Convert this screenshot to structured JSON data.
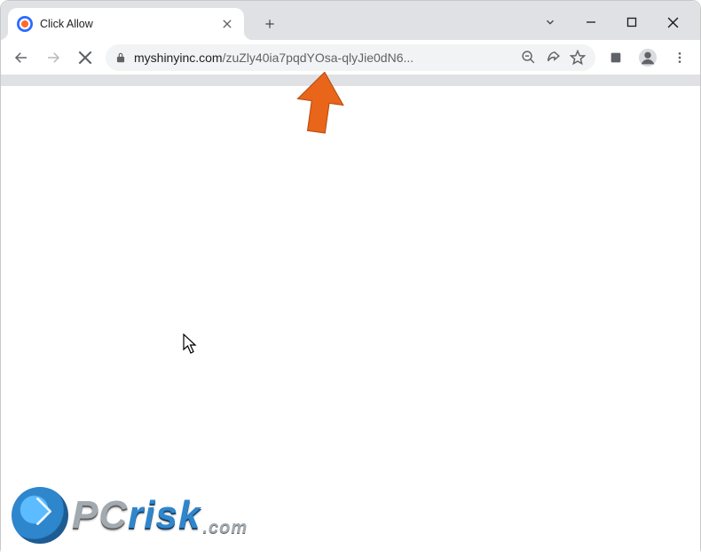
{
  "window": {
    "controls": {
      "dropdown_icon": "chevron-down",
      "minimize_icon": "minimize",
      "maximize_icon": "maximize",
      "close_icon": "close"
    }
  },
  "tab": {
    "title": "Click Allow",
    "favicon": "site-favicon",
    "close_icon": "close"
  },
  "newtab": {
    "icon": "plus"
  },
  "nav": {
    "back_icon": "arrow-left",
    "forward_icon": "arrow-right",
    "stop_icon": "stop-x"
  },
  "omnibox": {
    "lock_icon": "lock",
    "domain": "myshinyinc.com",
    "path": "/zuZly40ia7pqdYOsa-qlyJie0dN6...",
    "zoom_icon": "search-minus",
    "share_icon": "share",
    "bookmark_icon": "star"
  },
  "toolbar_right": {
    "extensions_icon": "extensions-square",
    "profile_icon": "profile",
    "menu_icon": "kebab-menu"
  },
  "watermark": {
    "brand_pc": "PC",
    "brand_risk": "risk",
    "tld": ".com"
  }
}
